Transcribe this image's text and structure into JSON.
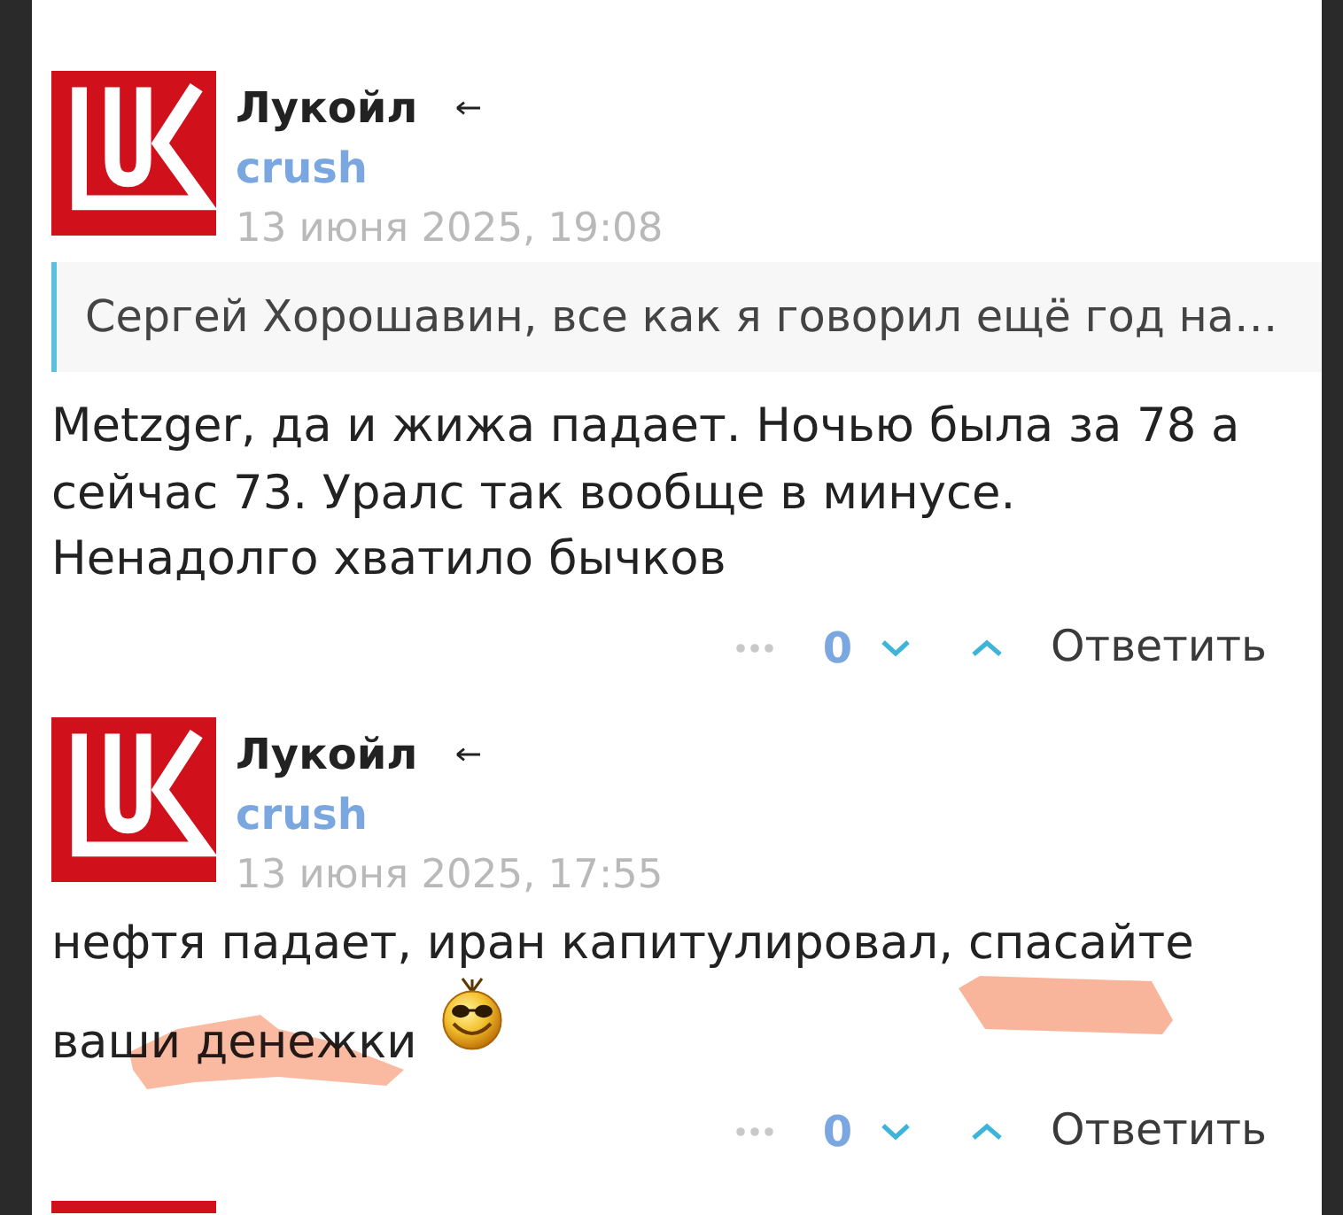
{
  "posts": [
    {
      "kind": "comment",
      "author": "Лукойл",
      "user": "crush",
      "date": "13 июня 2025, 19:08",
      "quote": "Сергей Хорошавин, все как я говорил ещё год на…",
      "text": "Metzger, да и жижа падает. Ночью была за 78 а сейчас 73. Уралс так вообще в минусе. Ненадолго хватило бычков",
      "score": "0",
      "reply_label": "Ответить"
    },
    {
      "kind": "comment",
      "author": "Лукойл",
      "user": "crush",
      "date": "13 июня 2025, 17:55",
      "text": "нефтя падает, иран капитулировал, спасайте ваши денежки",
      "emoticon": true,
      "highlighter_marks": true,
      "score": "0",
      "reply_label": "Ответить"
    },
    {
      "kind": "cut_off"
    }
  ]
}
